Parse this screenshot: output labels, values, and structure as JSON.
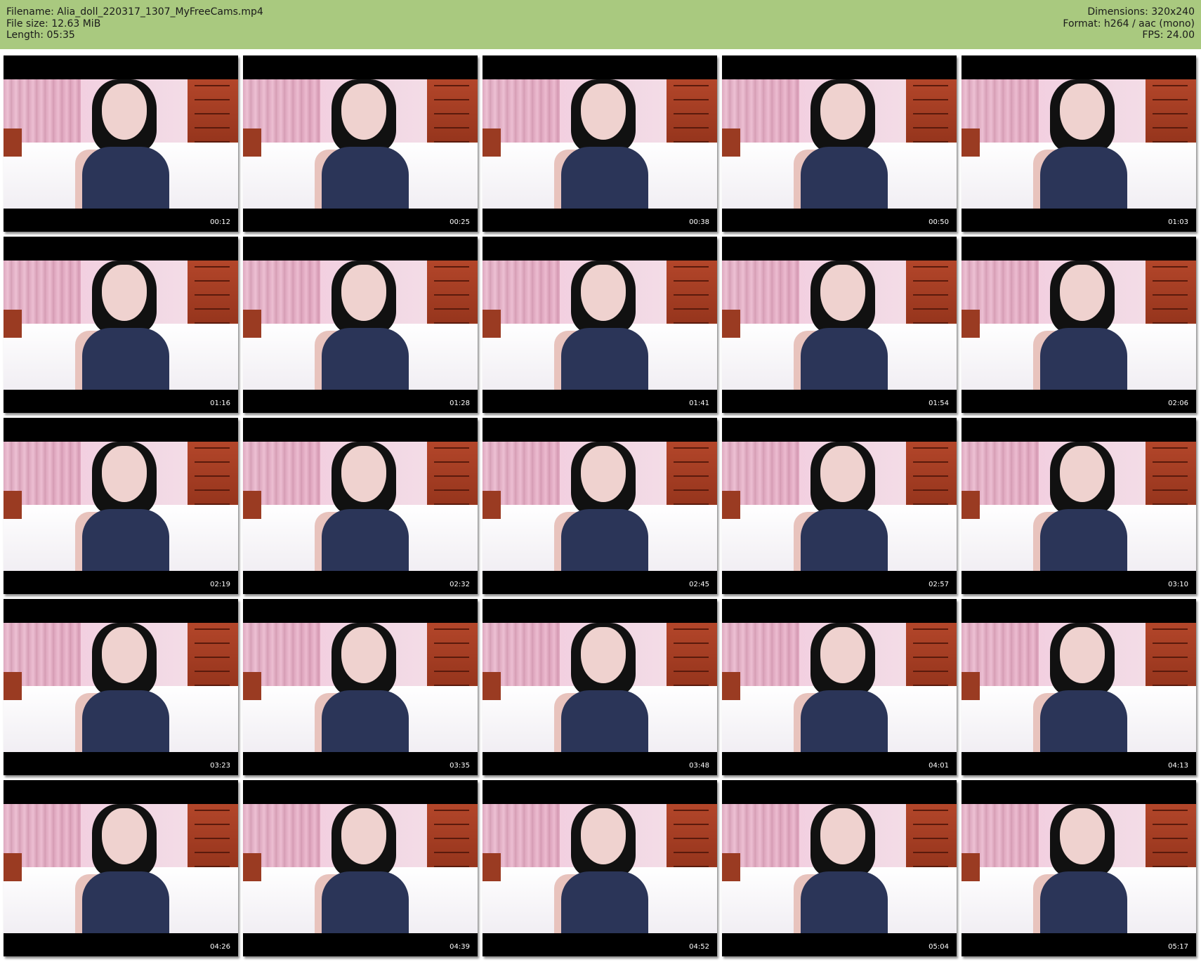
{
  "header": {
    "filename": "Filename: Alia_doll_220317_1307_MyFreeCams.mp4",
    "file_size": "File size: 12.63 MiB",
    "length": "Length: 05:35",
    "dimensions": "Dimensions: 320x240",
    "format": "Format: h264 / aac (mono)",
    "fps": "FPS: 24.00"
  },
  "colors": {
    "header_background": "#a9c97f",
    "page_background": "#ffffff"
  },
  "thumbnails": [
    {
      "timestamp": "00:12"
    },
    {
      "timestamp": "00:25"
    },
    {
      "timestamp": "00:38"
    },
    {
      "timestamp": "00:50"
    },
    {
      "timestamp": "01:03"
    },
    {
      "timestamp": "01:16"
    },
    {
      "timestamp": "01:28"
    },
    {
      "timestamp": "01:41"
    },
    {
      "timestamp": "01:54"
    },
    {
      "timestamp": "02:06"
    },
    {
      "timestamp": "02:19"
    },
    {
      "timestamp": "02:32"
    },
    {
      "timestamp": "02:45"
    },
    {
      "timestamp": "02:57"
    },
    {
      "timestamp": "03:10"
    },
    {
      "timestamp": "03:23"
    },
    {
      "timestamp": "03:35"
    },
    {
      "timestamp": "03:48"
    },
    {
      "timestamp": "04:01"
    },
    {
      "timestamp": "04:13"
    },
    {
      "timestamp": "04:26"
    },
    {
      "timestamp": "04:39"
    },
    {
      "timestamp": "04:52"
    },
    {
      "timestamp": "05:04"
    },
    {
      "timestamp": "05:17"
    }
  ]
}
